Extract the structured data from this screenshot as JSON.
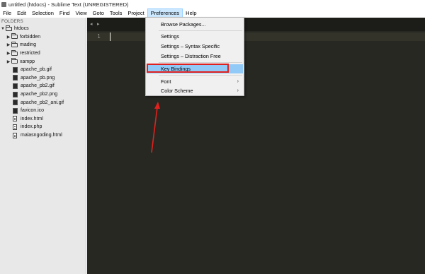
{
  "window": {
    "title": "untitled (htdocs) - Sublime Text (UNREGISTERED)"
  },
  "menubar": {
    "items": [
      "File",
      "Edit",
      "Selection",
      "Find",
      "View",
      "Goto",
      "Tools",
      "Project",
      "Preferences",
      "Help"
    ],
    "active": "Preferences"
  },
  "sidebar": {
    "header": "FOLDERS",
    "root": "htdocs",
    "folders": [
      "forbidden",
      "mading",
      "restricted",
      "xampp"
    ],
    "files": [
      {
        "name": "apache_pb.gif",
        "kind": "image"
      },
      {
        "name": "apache_pb.png",
        "kind": "image"
      },
      {
        "name": "apache_pb2.gif",
        "kind": "image"
      },
      {
        "name": "apache_pb2.png",
        "kind": "image"
      },
      {
        "name": "apache_pb2_ani.gif",
        "kind": "image"
      },
      {
        "name": "favicon.ico",
        "kind": "image"
      },
      {
        "name": "index.html",
        "kind": "doc"
      },
      {
        "name": "index.php",
        "kind": "doc"
      },
      {
        "name": "malasngoding.html",
        "kind": "doc"
      }
    ]
  },
  "editor": {
    "line_number": "1",
    "tab_nav_left": "◂",
    "tab_nav_right": "▸"
  },
  "preferences_menu": {
    "browse_packages": "Browse Packages...",
    "settings": "Settings",
    "settings_syntax": "Settings – Syntax Specific",
    "settings_distraction": "Settings – Distraction Free",
    "key_bindings": "Key Bindings",
    "font": "Font",
    "color_scheme": "Color Scheme",
    "submenu_arrow": "›"
  },
  "colors": {
    "editor_bg": "#272822",
    "sidebar_bg": "#e8e8e8",
    "menu_highlight": "#91c9f7",
    "annotation_red": "#e0201e"
  }
}
